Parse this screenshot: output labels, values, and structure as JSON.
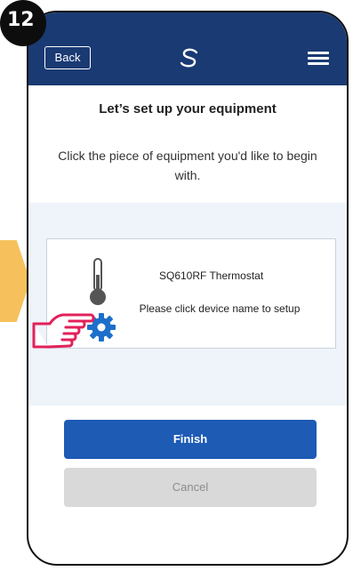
{
  "step": {
    "number": "12"
  },
  "header": {
    "back_label": "Back",
    "logo_icon": "salus-logo-icon",
    "menu_icon": "hamburger-menu-icon",
    "background_color": "#1a3a73"
  },
  "page": {
    "title": "Let’s set up your equipment",
    "intro": "Click the piece of equipment you'd like to begin with."
  },
  "device": {
    "name": "SQ610RF Thermostat",
    "hint": "Please click device name to setup",
    "icon": "thermometer-icon",
    "status_icon": "gear-icon"
  },
  "buttons": {
    "finish_label": "Finish",
    "cancel_label": "Cancel",
    "finish_color": "#1d5bb5",
    "cancel_color": "#d9d9d9"
  },
  "annotations": {
    "pointer_icon": "pointing-hand-icon",
    "accent_color": "#e2215a",
    "arrow_color": "#f6c15c"
  }
}
